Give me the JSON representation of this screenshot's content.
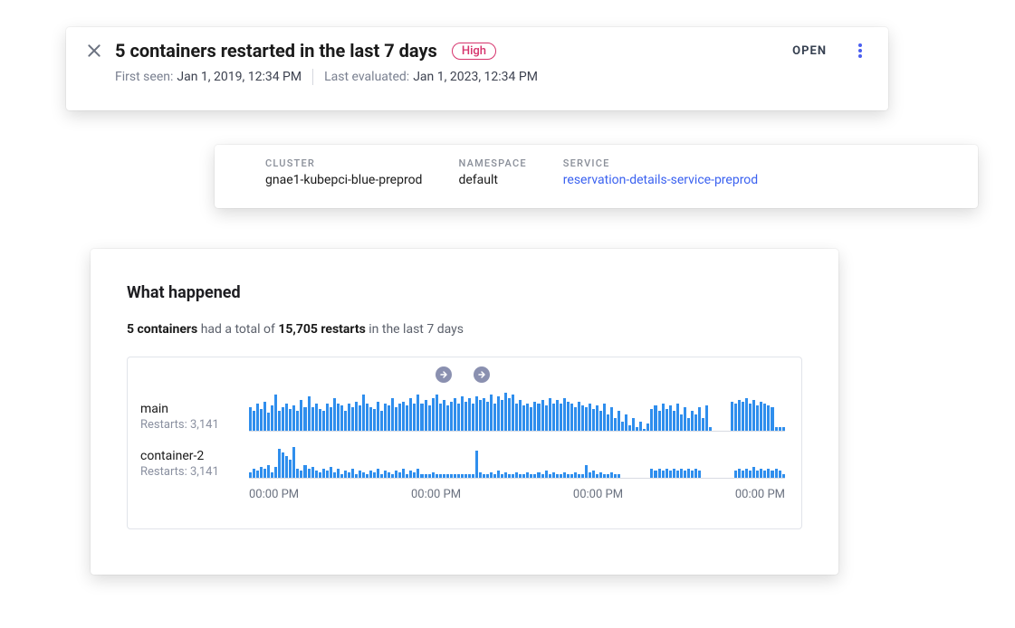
{
  "header": {
    "title": "5 containers restarted in the last 7 days",
    "severity": "High",
    "status": "OPEN",
    "first_seen_label": "First seen:",
    "first_seen_value": "Jan 1, 2019, 12:34 PM",
    "last_evaluated_label": "Last evaluated:",
    "last_evaluated_value": "Jan 1, 2023, 12:34 PM"
  },
  "meta": {
    "cluster_label": "CLUSTER",
    "cluster_value": "gnae1-kubepci-blue-preprod",
    "namespace_label": "NAMESPACE",
    "namespace_value": "default",
    "service_label": "SERVICE",
    "service_value": "reservation-details-service-preprod"
  },
  "what": {
    "title": "What happened",
    "summary_containers": "5 containers",
    "summary_mid": " had a total of ",
    "summary_restarts": "15,705 restarts",
    "summary_suffix": " in the last 7 days",
    "axis_ticks": [
      "00:00 PM",
      "00:00 PM",
      "00:00 PM",
      "00:00 PM"
    ],
    "series": [
      {
        "name": "main",
        "restarts_label": "Restarts: 3,141"
      },
      {
        "name": "container-2",
        "restarts_label": "Restarts: 3,141"
      }
    ]
  },
  "chart_data": [
    {
      "type": "bar",
      "title": "main",
      "xlabel": "",
      "ylabel": "",
      "ylim": [
        0,
        48
      ],
      "categories": [],
      "values": [
        26,
        22,
        30,
        24,
        32,
        20,
        28,
        40,
        22,
        26,
        30,
        24,
        28,
        22,
        34,
        26,
        38,
        26,
        30,
        24,
        22,
        30,
        26,
        36,
        30,
        28,
        22,
        30,
        26,
        32,
        28,
        40,
        30,
        26,
        24,
        32,
        22,
        30,
        28,
        36,
        26,
        30,
        32,
        28,
        36,
        30,
        40,
        30,
        34,
        28,
        36,
        40,
        30,
        34,
        28,
        32,
        36,
        30,
        38,
        32,
        36,
        30,
        38,
        34,
        36,
        32,
        40,
        30,
        38,
        34,
        42,
        36,
        40,
        30,
        34,
        28,
        30,
        26,
        32,
        30,
        34,
        28,
        36,
        30,
        34,
        30,
        36,
        32,
        30,
        26,
        32,
        28,
        26,
        30,
        24,
        28,
        22,
        30,
        18,
        26,
        14,
        22,
        10,
        18,
        6,
        14,
        4,
        10,
        2,
        8,
        24,
        28,
        22,
        30,
        24,
        28,
        22,
        30,
        18,
        26,
        14,
        22,
        18,
        26,
        14,
        28,
        4,
        0,
        0,
        0,
        0,
        0,
        32,
        30,
        34,
        32,
        36,
        30,
        34,
        28,
        32,
        30,
        28,
        26,
        4,
        4,
        4
      ]
    },
    {
      "type": "bar",
      "title": "container-2",
      "xlabel": "",
      "ylabel": "",
      "ylim": [
        0,
        48
      ],
      "categories": [],
      "values": [
        6,
        10,
        8,
        12,
        10,
        14,
        6,
        12,
        32,
        28,
        24,
        20,
        34,
        10,
        8,
        14,
        10,
        12,
        8,
        6,
        10,
        8,
        12,
        6,
        10,
        4,
        8,
        6,
        10,
        4,
        8,
        6,
        4,
        8,
        6,
        10,
        4,
        8,
        6,
        4,
        8,
        6,
        10,
        4,
        8,
        6,
        10,
        4,
        4,
        4,
        6,
        4,
        4,
        4,
        4,
        4,
        4,
        4,
        4,
        4,
        4,
        4,
        30,
        6,
        4,
        4,
        6,
        4,
        8,
        4,
        6,
        4,
        4,
        6,
        4,
        4,
        6,
        4,
        4,
        6,
        4,
        8,
        4,
        6,
        4,
        4,
        6,
        4,
        4,
        6,
        4,
        4,
        14,
        6,
        8,
        4,
        6,
        4,
        4,
        6,
        4,
        4,
        0,
        0,
        0,
        0,
        0,
        0,
        0,
        0,
        10,
        8,
        10,
        8,
        10,
        8,
        10,
        8,
        10,
        8,
        10,
        8,
        10,
        8,
        0,
        0,
        0,
        0,
        0,
        0,
        0,
        0,
        0,
        8,
        10,
        8,
        10,
        8,
        12,
        8,
        10,
        8,
        10,
        8,
        10,
        8,
        4
      ]
    }
  ]
}
